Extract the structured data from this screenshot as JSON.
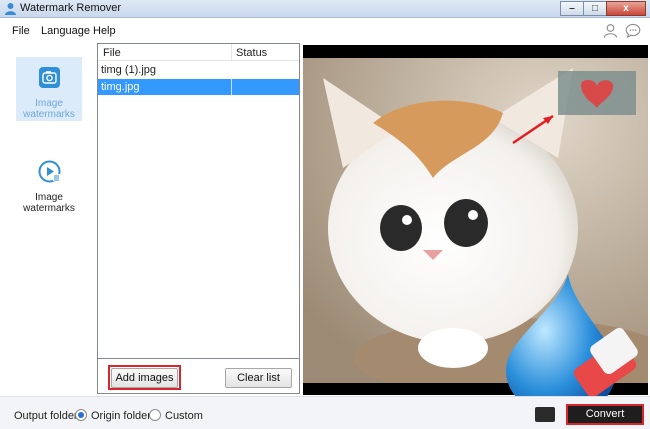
{
  "window": {
    "title": "Watermark Remover",
    "controls": {
      "minimize": "–",
      "maximize": "□",
      "close": "x"
    }
  },
  "menu": {
    "items": [
      "File",
      "Language",
      "Help"
    ]
  },
  "sidebar": {
    "items": [
      {
        "label": "Image watermarks",
        "icon": "image-watermark-icon",
        "active": true
      },
      {
        "label": "Image watermarks",
        "icon": "video-watermark-icon",
        "active": false
      }
    ]
  },
  "files": {
    "columns": {
      "file": "File",
      "status": "Status"
    },
    "rows": [
      {
        "name": "timg (1).jpg",
        "status": "",
        "selected": false
      },
      {
        "name": "timg.jpg",
        "status": "",
        "selected": true
      }
    ],
    "add_label": "Add images",
    "clear_label": "Clear list"
  },
  "footer": {
    "output_label": "Output folder",
    "options": [
      "Origin folder",
      "Custom"
    ],
    "selected": "Origin folder",
    "convert_label": "Convert"
  },
  "colors": {
    "accent": "#3399ff",
    "highlight": "#d9262c",
    "nav_active_bg": "#dcebf9",
    "nav_active_text": "#6fa7d8"
  }
}
